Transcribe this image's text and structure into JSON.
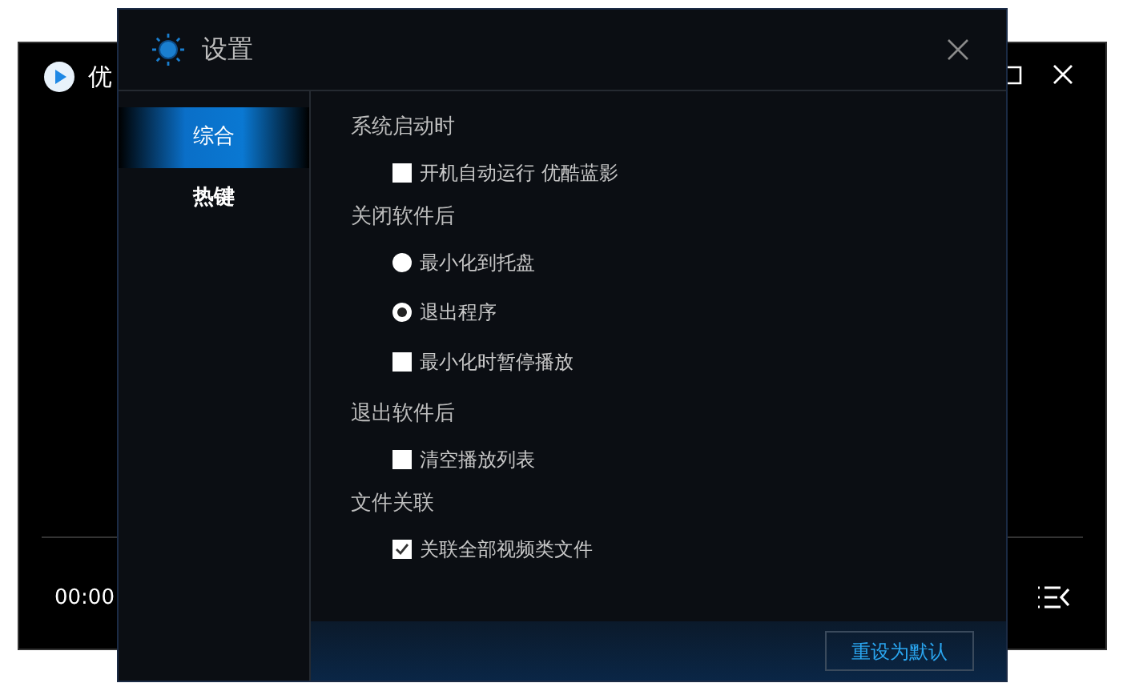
{
  "player": {
    "title": "优",
    "time": "00:00"
  },
  "dialog": {
    "title": "设置",
    "tabs": [
      {
        "label": "综合",
        "selected": true
      },
      {
        "label": "热键",
        "selected": false
      }
    ],
    "sections": [
      {
        "heading": "系统启动时",
        "options": [
          {
            "kind": "checkbox",
            "label": "开机自动运行 优酷蓝影",
            "checked": false
          }
        ]
      },
      {
        "heading": "关闭软件后",
        "options": [
          {
            "kind": "radio",
            "label": "最小化到托盘",
            "selected": false
          },
          {
            "kind": "radio",
            "label": "退出程序",
            "selected": true
          },
          {
            "kind": "checkbox",
            "label": "最小化时暂停播放",
            "checked": false
          }
        ]
      },
      {
        "heading": "退出软件后",
        "options": [
          {
            "kind": "checkbox",
            "label": "清空播放列表",
            "checked": false
          }
        ]
      },
      {
        "heading": "文件关联",
        "options": [
          {
            "kind": "checkbox",
            "label": "关联全部视频类文件",
            "checked": true
          }
        ]
      }
    ],
    "reset_button": "重设为默认"
  }
}
